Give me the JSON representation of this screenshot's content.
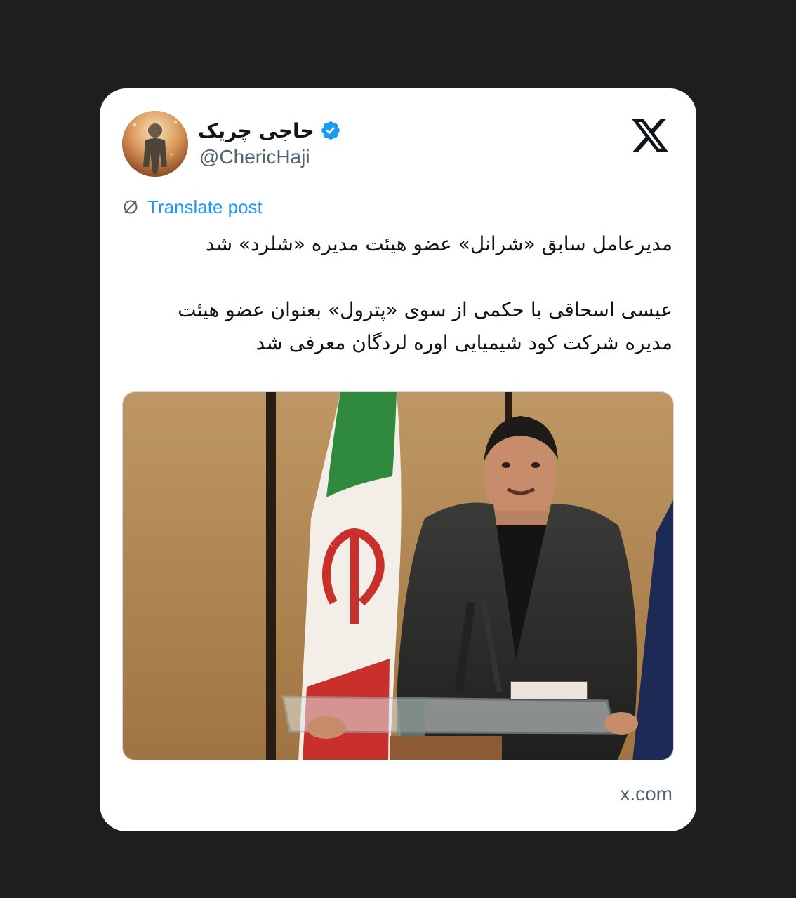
{
  "post": {
    "display_name": "حاجی چریک",
    "handle": "@ChericHaji",
    "verified": true,
    "translate_label": "Translate post",
    "text_paragraphs": [
      "مدیرعامل سابق «شرانل» عضو هیئت مدیره «شلرد» شد",
      "عیسی اسحاقی با حکمی از سوی «پترول» بعنوان عضو هیئت مدیره شرکت کود شیمیایی اوره لردگان معرفی شد"
    ],
    "source_domain": "x.com"
  },
  "icons": {
    "platform_logo": "x-logo-icon",
    "verified_badge": "verified-badge-icon",
    "translate": "translate-globe-icon"
  },
  "colors": {
    "background": "#1e1e1e",
    "card": "#ffffff",
    "link_blue": "#1d9bf0",
    "secondary_text": "#536471",
    "primary_text": "#0f1419"
  }
}
